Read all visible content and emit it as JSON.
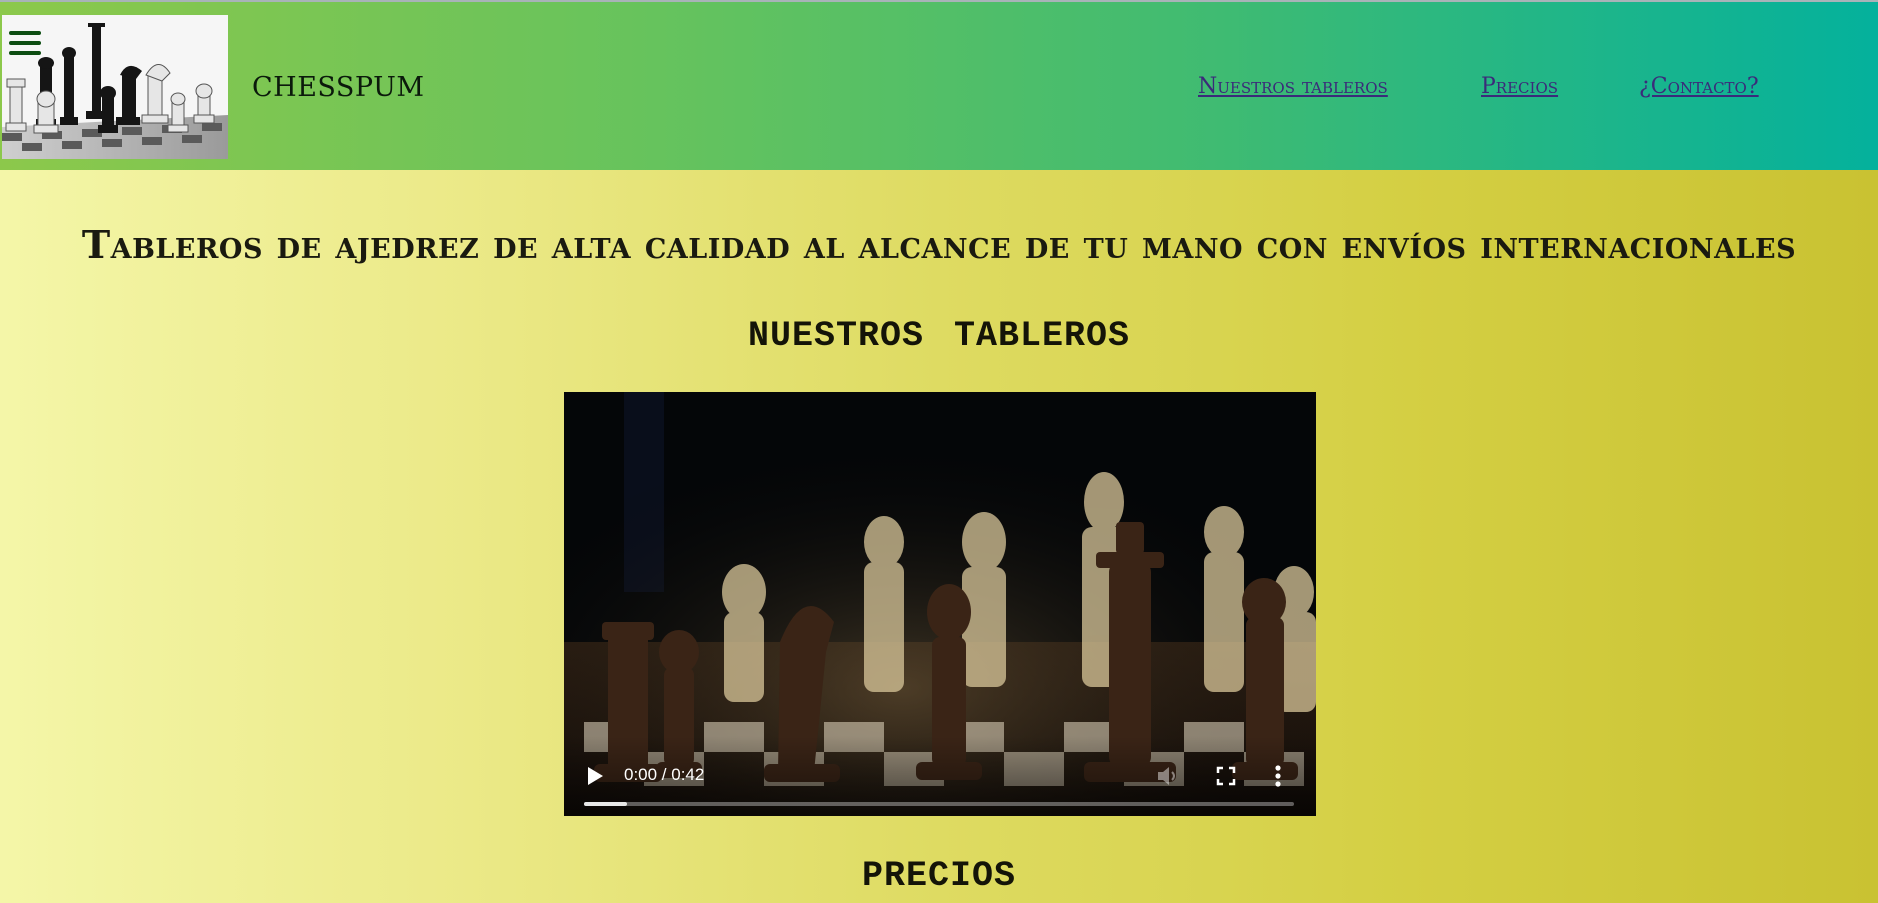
{
  "header": {
    "brand": "CHESSPUM",
    "nav": [
      {
        "label": "Nuestros tableros"
      },
      {
        "label": "Precios"
      },
      {
        "label": "¿Contacto?"
      }
    ],
    "icons": {
      "menu": "hamburger-menu-icon",
      "logo": "chess-pieces-logo-image"
    }
  },
  "main": {
    "headline": "Tableros de ajedrez de alta calidad al alcance de tu mano con envíos internacionales",
    "section_boards": "NUESTROS TABLEROS",
    "section_prices": "PRECIOS",
    "video": {
      "time": "0:00 / 0:42",
      "progress": 0.06,
      "icons": [
        "play-icon",
        "mute-icon",
        "fullscreen-icon",
        "more-options-icon"
      ]
    }
  },
  "colors": {
    "header_gradient_start": "#8cc84b",
    "header_gradient_end": "#04b19c",
    "page_gradient_start": "#f4f6a8",
    "page_gradient_end": "#c9c232",
    "nav_link": "#3b2a7a",
    "menu_icon": "#0d4d12"
  }
}
